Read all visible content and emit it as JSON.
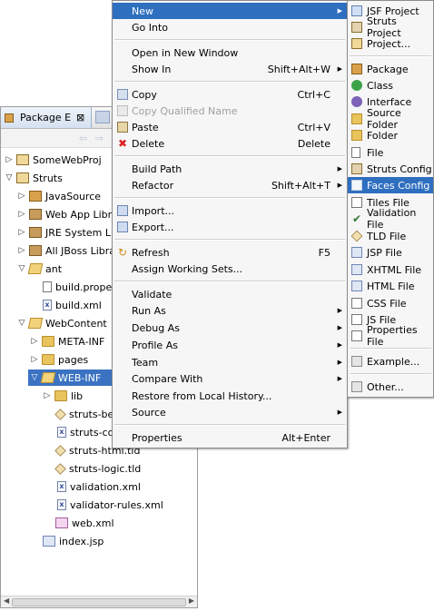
{
  "explorer": {
    "tab_label": "Package E",
    "close_glyph": "⊠",
    "tree": [
      {
        "label": "SomeWebProj",
        "icon": "project-icon",
        "twisty": "▷"
      },
      {
        "label": "Struts",
        "icon": "project-icon",
        "twisty": "▽"
      },
      {
        "label": "JavaSource",
        "icon": "source-folder-icon",
        "twisty": "▷"
      },
      {
        "label": "Web App Libra",
        "icon": "library-icon",
        "twisty": "▷"
      },
      {
        "label": "JRE System Lib",
        "icon": "library-icon",
        "twisty": "▷"
      },
      {
        "label": "All JBoss Librar",
        "icon": "library-icon",
        "twisty": "▷"
      },
      {
        "label": "ant",
        "icon": "folder-open-icon",
        "twisty": "▽"
      },
      {
        "label": "build.proper",
        "icon": "file-icon",
        "twisty": ""
      },
      {
        "label": "build.xml",
        "icon": "xml-file-icon",
        "twisty": ""
      },
      {
        "label": "WebContent",
        "icon": "folder-open-icon",
        "twisty": "▽"
      },
      {
        "label": "META-INF",
        "icon": "folder-icon",
        "twisty": "▷"
      },
      {
        "label": "pages",
        "icon": "folder-icon",
        "twisty": "▷"
      },
      {
        "label": "WEB-INF",
        "icon": "folder-open-icon",
        "twisty": "▽"
      },
      {
        "label": "lib",
        "icon": "folder-icon",
        "twisty": "▷"
      },
      {
        "label": "struts-be",
        "icon": "tld-file-icon",
        "twisty": ""
      },
      {
        "label": "struts-co",
        "icon": "xml-file-icon",
        "twisty": ""
      },
      {
        "label": "struts-html.tld",
        "icon": "tld-file-icon",
        "twisty": ""
      },
      {
        "label": "struts-logic.tld",
        "icon": "tld-file-icon",
        "twisty": ""
      },
      {
        "label": "validation.xml",
        "icon": "xml-file-icon",
        "twisty": ""
      },
      {
        "label": "validator-rules.xml",
        "icon": "xml-file-icon",
        "twisty": ""
      },
      {
        "label": "web.xml",
        "icon": "web-xml-icon",
        "twisty": ""
      },
      {
        "label": "index.jsp",
        "icon": "jsp-file-icon",
        "twisty": ""
      }
    ]
  },
  "context_menu": {
    "new": {
      "label": "New"
    },
    "go_into": {
      "label": "Go Into"
    },
    "open_new_window": {
      "label": "Open in New Window"
    },
    "show_in": {
      "label": "Show In",
      "shortcut": "Shift+Alt+W"
    },
    "copy": {
      "label": "Copy",
      "shortcut": "Ctrl+C"
    },
    "copy_qualified": {
      "label": "Copy Qualified Name"
    },
    "paste": {
      "label": "Paste",
      "shortcut": "Ctrl+V"
    },
    "delete": {
      "label": "Delete",
      "shortcut": "Delete"
    },
    "build_path": {
      "label": "Build Path"
    },
    "refactor": {
      "label": "Refactor",
      "shortcut": "Shift+Alt+T"
    },
    "import": {
      "label": "Import..."
    },
    "export": {
      "label": "Export..."
    },
    "refresh": {
      "label": "Refresh",
      "shortcut": "F5"
    },
    "assign_working_sets": {
      "label": "Assign Working Sets..."
    },
    "validate": {
      "label": "Validate"
    },
    "run_as": {
      "label": "Run As"
    },
    "debug_as": {
      "label": "Debug As"
    },
    "profile_as": {
      "label": "Profile As"
    },
    "team": {
      "label": "Team"
    },
    "compare_with": {
      "label": "Compare With"
    },
    "restore_history": {
      "label": "Restore from Local History..."
    },
    "source": {
      "label": "Source"
    },
    "properties": {
      "label": "Properties",
      "shortcut": "Alt+Enter"
    }
  },
  "new_submenu": {
    "jsf_project": "JSF Project",
    "struts_project": "Struts Project",
    "project": "Project...",
    "package": "Package",
    "class": "Class",
    "interface": "Interface",
    "source_folder": "Source Folder",
    "folder": "Folder",
    "file": "File",
    "struts_config": "Struts Config",
    "faces_config": "Faces Config",
    "tiles_file": "Tiles File",
    "validation_file": "Validation File",
    "tld_file": "TLD File",
    "jsp_file": "JSP File",
    "xhtml_file": "XHTML File",
    "html_file": "HTML File",
    "css_file": "CSS File",
    "js_file": "JS File",
    "properties_file": "Properties File",
    "example": "Example...",
    "other": "Other..."
  },
  "colors": {
    "highlight": "#2f6fc0",
    "selection": "#3b73c2"
  }
}
